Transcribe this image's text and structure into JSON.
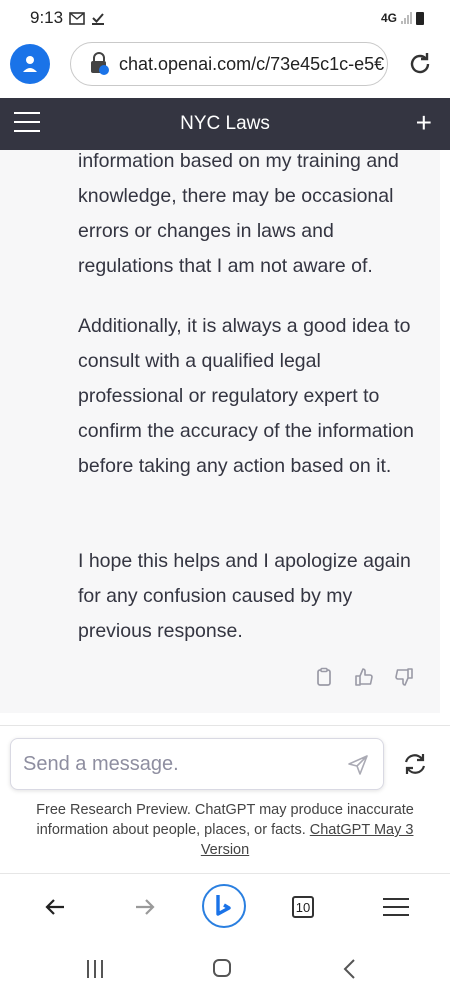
{
  "status_bar": {
    "time": "9:13",
    "network": "4G"
  },
  "browser": {
    "url": "chat.openai.com/c/73e45c1c-e5€",
    "tab_count": "10"
  },
  "chat": {
    "title": "NYC Laws",
    "paragraphs": [
      "information based on my training and knowledge, there may be occasional errors or changes in laws and regulations that I am not aware of.",
      "Additionally, it is always a good idea to consult with a qualified legal professional or regulatory expert to confirm the accuracy of the information before taking any action based on it.",
      "I hope this helps and I apologize again for any confusion caused by my previous response."
    ]
  },
  "composer": {
    "placeholder": "Send a message."
  },
  "disclaimer": {
    "text": "Free Research Preview. ChatGPT may produce inaccurate information about people, places, or facts. ",
    "link": "ChatGPT May 3 Version"
  },
  "colors": {
    "header_bg": "#343541",
    "accent": "#1a73e8",
    "message_bg": "#f7f7f8"
  }
}
